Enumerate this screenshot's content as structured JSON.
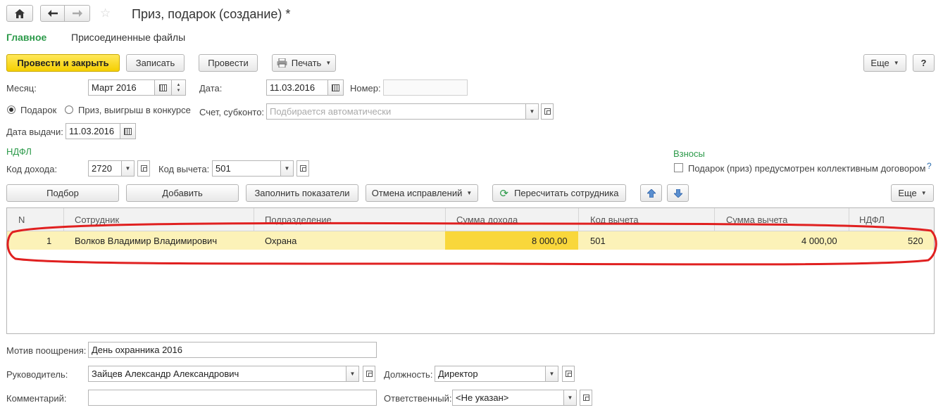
{
  "window": {
    "title": "Приз, подарок (создание) *",
    "help_label": "?"
  },
  "nav": {
    "home_icon": "home-icon",
    "back_icon": "arrow-left-icon",
    "forward_icon": "arrow-right-icon",
    "star_icon": "star-icon"
  },
  "tabs": [
    {
      "label": "Главное",
      "active": true
    },
    {
      "label": "Присоединенные файлы",
      "active": false
    }
  ],
  "toolbar": {
    "post_close": "Провести и закрыть",
    "save": "Записать",
    "post": "Провести",
    "print": "Печать",
    "more": "Еще"
  },
  "form": {
    "month_label": "Месяц:",
    "month_value": "Март 2016",
    "date_label": "Дата:",
    "date_value": "11.03.2016",
    "number_label": "Номер:",
    "number_value": "",
    "radio_gift": "Подарок",
    "radio_prize": "Приз, выигрыш в конкурсе",
    "account_label": "Счет, субконто:",
    "account_placeholder": "Подбирается автоматически",
    "issue_date_label": "Дата выдачи:",
    "issue_date_value": "11.03.2016",
    "ndfl_header": "НДФЛ",
    "income_code_label": "Код дохода:",
    "income_code_value": "2720",
    "deduction_code_label": "Код вычета:",
    "deduction_code_value": "501",
    "contrib_header": "Взносы",
    "contrib_check_label": "Подарок (приз) предусмотрен коллективным договором",
    "contrib_help": "?"
  },
  "table_toolbar": {
    "select": "Подбор",
    "add": "Добавить",
    "fill": "Заполнить показатели",
    "cancel_fix": "Отмена исправлений",
    "recalc": "Пересчитать сотрудника",
    "more": "Еще"
  },
  "table": {
    "headers": [
      "N",
      "Сотрудник",
      "Подразделение",
      "Сумма дохода",
      "Код вычета",
      "Сумма вычета",
      "НДФЛ"
    ],
    "rows": [
      [
        "1",
        "Волков Владимир Владимирович",
        "Охрана",
        "8 000,00",
        "501",
        "4 000,00",
        "520"
      ]
    ]
  },
  "footer": {
    "motive_label": "Мотив поощрения:",
    "motive_value": "День охранника 2016",
    "head_label": "Руководитель:",
    "head_value": "Зайцев Александр Александрович",
    "position_label": "Должность:",
    "position_value": "Директор",
    "comment_label": "Комментарий:",
    "comment_value": "",
    "responsible_label": "Ответственный:",
    "responsible_value": "<Не указан>"
  },
  "colors": {
    "accent_green": "#2c9a4a",
    "primary_button": "#f5cf00",
    "row_highlight": "#fcf2b8",
    "annotation_red": "#e02020"
  }
}
